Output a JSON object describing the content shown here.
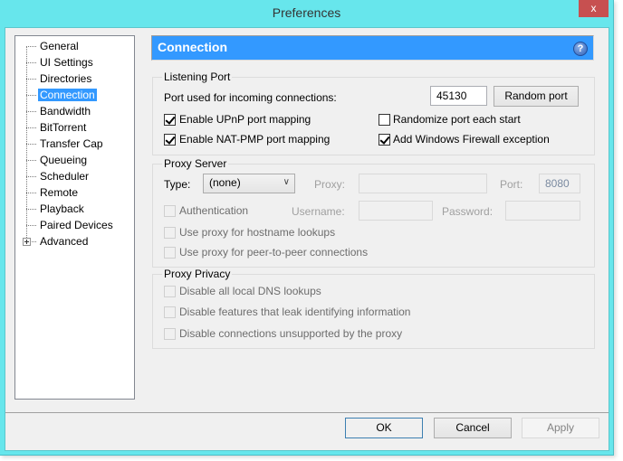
{
  "window": {
    "title": "Preferences",
    "close_label": "x"
  },
  "sidebar": {
    "items": [
      {
        "label": "General"
      },
      {
        "label": "UI Settings"
      },
      {
        "label": "Directories"
      },
      {
        "label": "Connection",
        "selected": true
      },
      {
        "label": "Bandwidth"
      },
      {
        "label": "BitTorrent"
      },
      {
        "label": "Transfer Cap"
      },
      {
        "label": "Queueing"
      },
      {
        "label": "Scheduler"
      },
      {
        "label": "Remote"
      },
      {
        "label": "Playback"
      },
      {
        "label": "Paired Devices"
      },
      {
        "label": "Advanced",
        "expandable": true
      }
    ]
  },
  "header": {
    "title": "Connection",
    "help_icon": "?"
  },
  "listening_port": {
    "group_label": "Listening Port",
    "port_label": "Port used for incoming connections:",
    "port_value": "45130",
    "random_port_label": "Random port",
    "upnp": {
      "label": "Enable UPnP port mapping",
      "checked": true
    },
    "natpmp": {
      "label": "Enable NAT-PMP port mapping",
      "checked": true
    },
    "randomize": {
      "label": "Randomize port each start",
      "checked": false
    },
    "firewall": {
      "label": "Add Windows Firewall exception",
      "checked": true
    }
  },
  "proxy_server": {
    "group_label": "Proxy Server",
    "type_label": "Type:",
    "type_value": "(none)",
    "proxy_label": "Proxy:",
    "proxy_value": "",
    "port_label": "Port:",
    "port_value": "8080",
    "auth": {
      "label": "Authentication",
      "checked": false,
      "disabled": true
    },
    "username_label": "Username:",
    "username_value": "",
    "password_label": "Password:",
    "password_value": "",
    "hostname_lookups": {
      "label": "Use proxy for hostname lookups",
      "checked": false,
      "disabled": true
    },
    "p2p": {
      "label": "Use proxy for peer-to-peer connections",
      "checked": false,
      "disabled": true
    }
  },
  "proxy_privacy": {
    "group_label": "Proxy Privacy",
    "dns": {
      "label": "Disable all local DNS lookups",
      "checked": false,
      "disabled": true
    },
    "leak": {
      "label": "Disable features that leak identifying information",
      "checked": false,
      "disabled": true
    },
    "unsupported": {
      "label": "Disable connections unsupported by the proxy",
      "checked": false,
      "disabled": true
    }
  },
  "footer": {
    "ok_label": "OK",
    "cancel_label": "Cancel",
    "apply_label": "Apply"
  },
  "colors": {
    "titlebar": "#67e6ec",
    "close": "#c75050",
    "accent": "#3399ff"
  }
}
